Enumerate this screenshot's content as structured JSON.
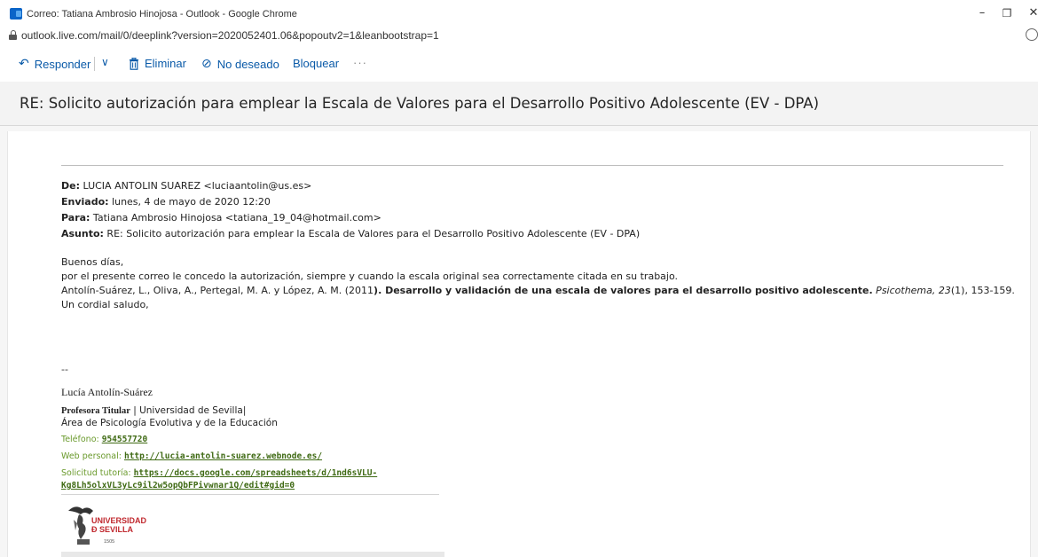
{
  "window": {
    "title": "Correo: Tatiana Ambrosio Hinojosa - Outlook - Google Chrome",
    "minimize": "–",
    "maximize": "❐",
    "close": "✕"
  },
  "address_bar": {
    "url": "outlook.live.com/mail/0/deeplink?version=2020052401.06&popoutv2=1&leanbootstrap=1"
  },
  "toolbar": {
    "reply_label": "Responder",
    "reply_icon": "↶",
    "dropdown_icon": "∨",
    "delete_label": "Eliminar",
    "delete_icon": "🗑",
    "junk_label": "No deseado",
    "junk_icon": "⊘",
    "block_label": "Bloquear",
    "more_label": "···"
  },
  "message": {
    "subject": "RE: Solicito autorización para emplear la Escala de Valores para el Desarrollo Positivo Adolescente (EV - DPA)",
    "header": {
      "from_label": "De:",
      "from_value": " LUCIA ANTOLIN SUAREZ <luciaantolin@us.es>",
      "sent_label": "Enviado:",
      "sent_value": " lunes, 4 de mayo de 2020 12:20",
      "to_label": "Para:",
      "to_value": " Tatiana Ambrosio Hinojosa <tatiana_19_04@hotmail.com>",
      "subject_label": "Asunto:",
      "subject_value": " RE: Solicito autorización para emplear la Escala de Valores para el Desarrollo Positivo Adolescente (EV - DPA)"
    },
    "body": {
      "greeting": "Buenos días,",
      "line1": "por el presente correo le concedo la autorización, siempre y cuando la escala original sea correctamente citada en su trabajo.",
      "citation_authors": "Antolín-Suárez, L., Oliva, A., Pertegal, M. A. y López, A. M. (2011",
      "citation_authors_close": ").",
      "citation_title": " Desarrollo y validación de una escala de valores para el desarrollo positivo adolescente.",
      "citation_journal": " Psicothema, 23",
      "citation_issue": "(1), 153-159.",
      "closing": "Un cordial saludo,"
    },
    "signature": {
      "dashes": "--",
      "name": "Lucía Antolín-Suárez",
      "title": "Profesora Titular",
      "affiliation": " | Universidad de Sevilla|",
      "department": "Área de Psicología Evolutiva y de la Educación",
      "phone_label": "Teléfono: ",
      "phone": "954557720",
      "web_label": "Web personal: ",
      "web": "http://lucia-antolin-suarez.webnode.es/",
      "tutoring_label": "Solicitud tutoría: ",
      "tutoring_link_1": "https://docs.google.com/spreadsheets/d/1nd6sVLU-",
      "tutoring_link_2": "Kg8Lh5olxVL3yLc9il2w5opQbFPivwnar1Q/edit#gid=0",
      "logo_line1": "UNIVERSIDAD",
      "logo_line2": "Ð SEVILLA",
      "logo_year": "1505"
    }
  },
  "colors": {
    "link_blue": "#0a5aa8",
    "signature_green": "#6a9a2c",
    "signature_link": "#3f6a14",
    "university_red": "#c0282e"
  }
}
